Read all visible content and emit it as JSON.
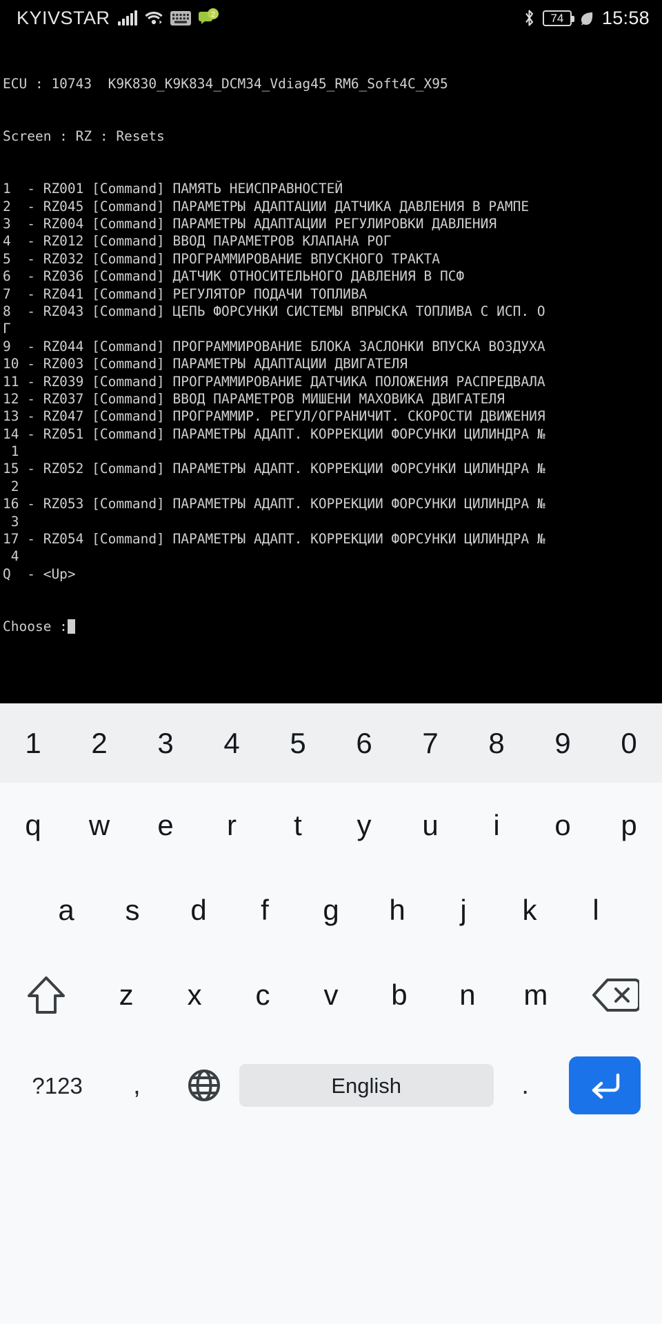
{
  "statusbar": {
    "carrier": "KYIVSTAR",
    "signal_icon": "signal-bars-icon",
    "wifi_icon": "wifi-icon",
    "keyboard_icon": "keyboard-icon",
    "chat_icon": "chat-badge-icon",
    "chat_badge_count": "2",
    "bluetooth_icon": "bluetooth-icon",
    "battery_level": "74",
    "battery_icon": "battery-icon",
    "leaf_icon": "leaf-icon",
    "clock": "15:58",
    "text_color": "#e8e8e8"
  },
  "terminal": {
    "background": "#000000",
    "text_color": "#cfcfcf",
    "header_ecu": "ECU : 10743  K9K830_K9K834_DCM34_Vdiag45_RM6_Soft4C_X95",
    "header_screen": "Screen : RZ : Resets",
    "lines": [
      "1  - RZ001 [Command] ПАМЯТЬ НЕИСПРАВНОСТЕЙ",
      "2  - RZ045 [Command] ПАРАМЕТРЫ АДАПТАЦИИ ДАТЧИКА ДАВЛЕНИЯ В РАМПЕ",
      "3  - RZ004 [Command] ПАРАМЕТРЫ АДАПТАЦИИ РЕГУЛИРОВКИ ДАВЛЕНИЯ",
      "4  - RZ012 [Command] ВВОД ПАРАМЕТРОВ КЛАПАНА РОГ",
      "5  - RZ032 [Command] ПРОГРАММИРОВАНИЕ ВПУСКНОГО ТРАКТА",
      "6  - RZ036 [Command] ДАТЧИК ОТНОСИТЕЛЬНОГО ДАВЛЕНИЯ В ПСФ",
      "7  - RZ041 [Command] РЕГУЛЯТОР ПОДАЧИ ТОПЛИВА",
      "8  - RZ043 [Command] ЦЕПЬ ФОРСУНКИ СИСТЕМЫ ВПРЫСКА ТОПЛИВА С ИСП. О",
      "Г",
      "9  - RZ044 [Command] ПРОГРАММИРОВАНИЕ БЛОКА ЗАСЛОНКИ ВПУСКА ВОЗДУХА",
      "10 - RZ003 [Command] ПАРАМЕТРЫ АДАПТАЦИИ ДВИГАТЕЛЯ",
      "11 - RZ039 [Command] ПРОГРАММИРОВАНИЕ ДАТЧИКА ПОЛОЖЕНИЯ РАСПРЕДВАЛА",
      "12 - RZ037 [Command] ВВОД ПАРАМЕТРОВ МИШЕНИ МАХОВИКА ДВИГАТЕЛЯ",
      "13 - RZ047 [Command] ПРОГРАММИР. РЕГУЛ/ОГРАНИЧИТ. СКОРОСТИ ДВИЖЕНИЯ",
      "14 - RZ051 [Command] ПАРАМЕТРЫ АДАПТ. КОРРЕКЦИИ ФОРСУНКИ ЦИЛИНДРА №",
      " 1",
      "15 - RZ052 [Command] ПАРАМЕТРЫ АДАПТ. КОРРЕКЦИИ ФОРСУНКИ ЦИЛИНДРА №",
      " 2",
      "16 - RZ053 [Command] ПАРАМЕТРЫ АДАПТ. КОРРЕКЦИИ ФОРСУНКИ ЦИЛИНДРА №",
      " 3",
      "17 - RZ054 [Command] ПАРАМЕТРЫ АДАПТ. КОРРЕКЦИИ ФОРСУНКИ ЦИЛИНДРА №",
      " 4",
      "Q  - <Up>"
    ],
    "prompt_label": "Choose :",
    "prompt_value": ""
  },
  "keyboard": {
    "language": "English",
    "symbols_key": "?123",
    "comma_key": ",",
    "period_key": ".",
    "globe_icon": "globe-icon",
    "shift_icon": "shift-icon",
    "backspace_icon": "backspace-icon",
    "enter_icon": "enter-icon",
    "enter_color": "#1a73e8",
    "number_row": [
      "1",
      "2",
      "3",
      "4",
      "5",
      "6",
      "7",
      "8",
      "9",
      "0"
    ],
    "row_q": [
      "q",
      "w",
      "e",
      "r",
      "t",
      "y",
      "u",
      "i",
      "o",
      "p"
    ],
    "row_a": [
      "a",
      "s",
      "d",
      "f",
      "g",
      "h",
      "j",
      "k",
      "l"
    ],
    "row_z": [
      "z",
      "x",
      "c",
      "v",
      "b",
      "n",
      "m"
    ]
  }
}
